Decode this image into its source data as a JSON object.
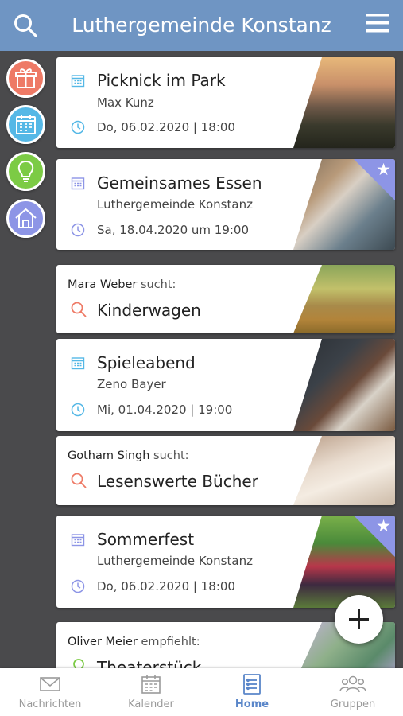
{
  "header": {
    "title": "Luthergemeinde Konstanz",
    "search_icon": "search-icon",
    "menu_icon": "hamburger-menu-icon"
  },
  "side_actions": [
    {
      "name": "gift-icon",
      "color": "#ee7a66"
    },
    {
      "name": "calendar-icon",
      "color": "#55b8e6"
    },
    {
      "name": "lightbulb-icon",
      "color": "#7ccb45"
    },
    {
      "name": "house-icon",
      "color": "#8d95e6"
    }
  ],
  "feed": {
    "events": [
      {
        "title": "Picknick im Park",
        "organizer": "Max Kunz",
        "date": "Do, 06.02.2020 | 18:00",
        "icon_color": "#55b8e6",
        "starred": false
      },
      {
        "title": "Gemeinsames Essen",
        "organizer": "Luthergemeinde Konstanz",
        "date": "Sa, 18.04.2020 um 19:00",
        "icon_color": "#8d95e6",
        "starred": true
      },
      {
        "title": "Spieleabend",
        "organizer": "Zeno Bayer",
        "date": "Mi, 01.04.2020 | 19:00",
        "icon_color": "#55b8e6",
        "starred": false
      },
      {
        "title": "Sommerfest",
        "organizer": "Luthergemeinde Konstanz",
        "date": "Do, 06.02.2020 | 18:00",
        "icon_color": "#8d95e6",
        "starred": true
      }
    ],
    "searches": [
      {
        "person": "Mara Weber",
        "verb": "sucht:",
        "item": "Kinderwagen"
      },
      {
        "person": "Gotham Singh",
        "verb": "sucht:",
        "item": "Lesenswerte Bücher"
      }
    ],
    "recommendation": {
      "person": "Oliver Meier",
      "verb": "empfiehlt:",
      "item": "Theaterstück"
    }
  },
  "fab": {
    "icon": "plus-icon"
  },
  "tabs": [
    {
      "label": "Nachrichten",
      "icon": "envelope-icon",
      "active": false
    },
    {
      "label": "Kalender",
      "icon": "calendar-icon",
      "active": false
    },
    {
      "label": "Home",
      "icon": "list-icon",
      "active": true
    },
    {
      "label": "Gruppen",
      "icon": "group-icon",
      "active": false
    }
  ],
  "colors": {
    "header": "#6f95c3",
    "background": "#4a4a4c",
    "search_accent": "#ee7a66",
    "active_tab": "#5a86c9"
  }
}
